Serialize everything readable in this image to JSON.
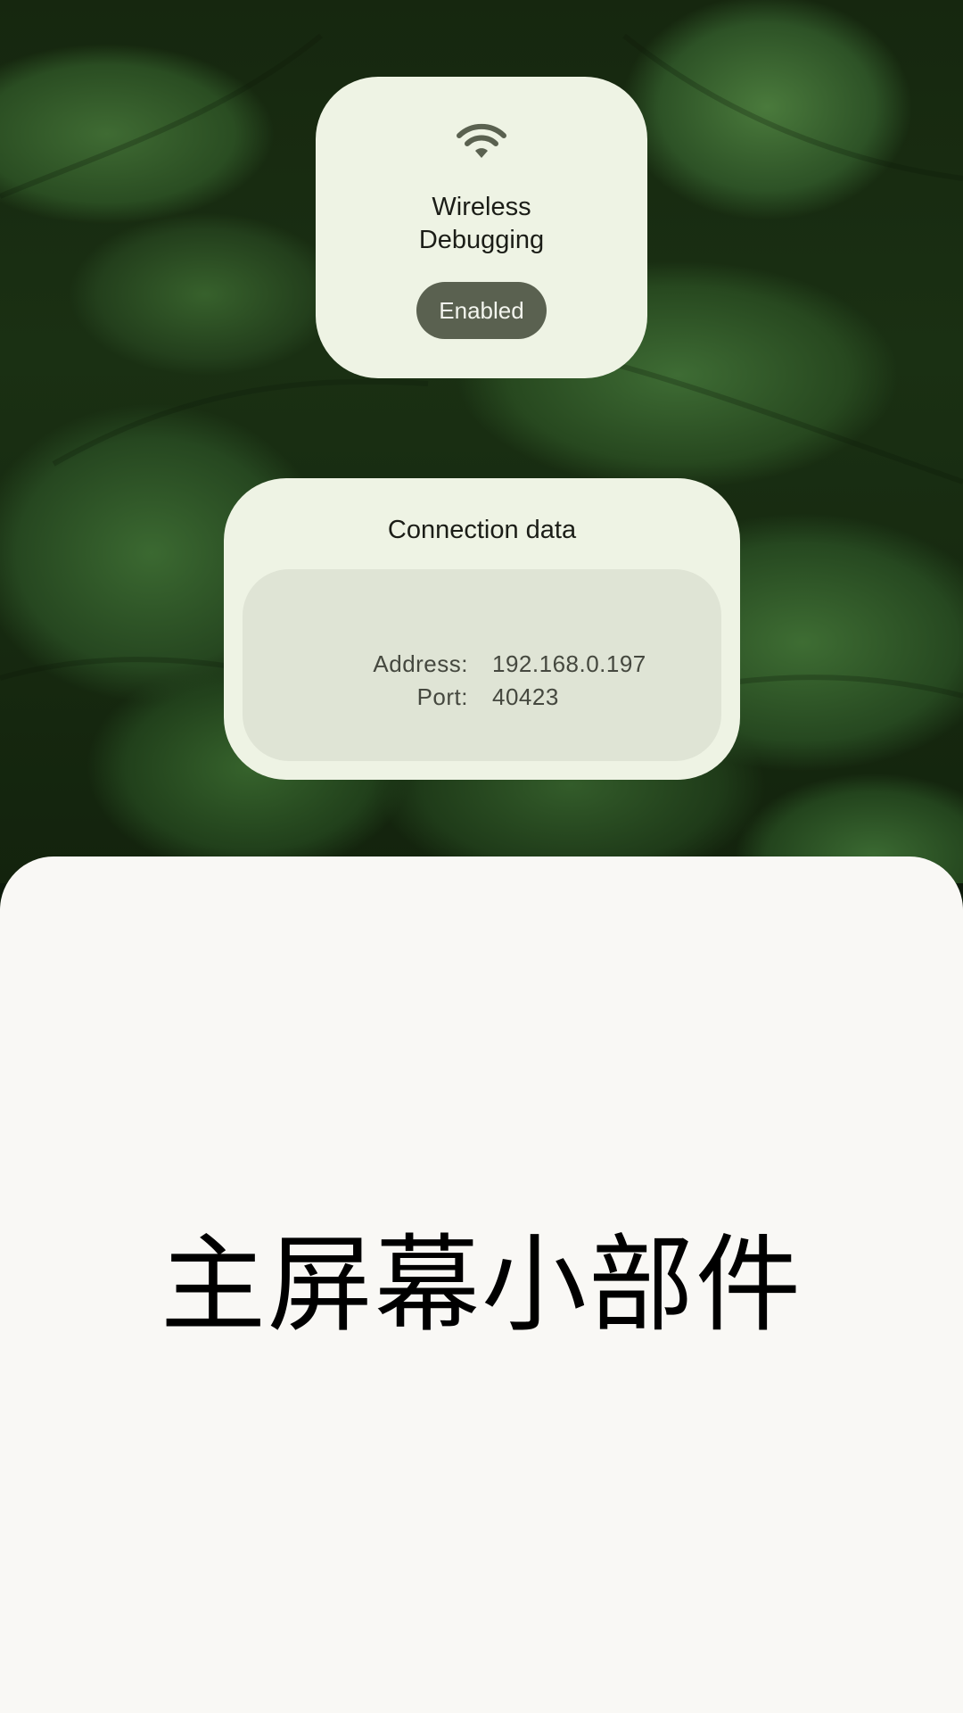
{
  "wifi_widget": {
    "icon": "wifi-icon",
    "title_line1": "Wireless",
    "title_line2": "Debugging",
    "status": "Enabled"
  },
  "connection_widget": {
    "title": "Connection data",
    "address_label": "Address:",
    "address_value": "192.168.0.197",
    "port_label": "Port:",
    "port_value": "40423"
  },
  "sheet": {
    "title": "主屏幕小部件"
  },
  "colors": {
    "widget_background": "#eef3e4",
    "inner_panel": "#dfe4d5",
    "status_pill": "#5a6150",
    "sheet_background": "#f9f8f5",
    "wallpaper_green": "#2a4d22"
  }
}
